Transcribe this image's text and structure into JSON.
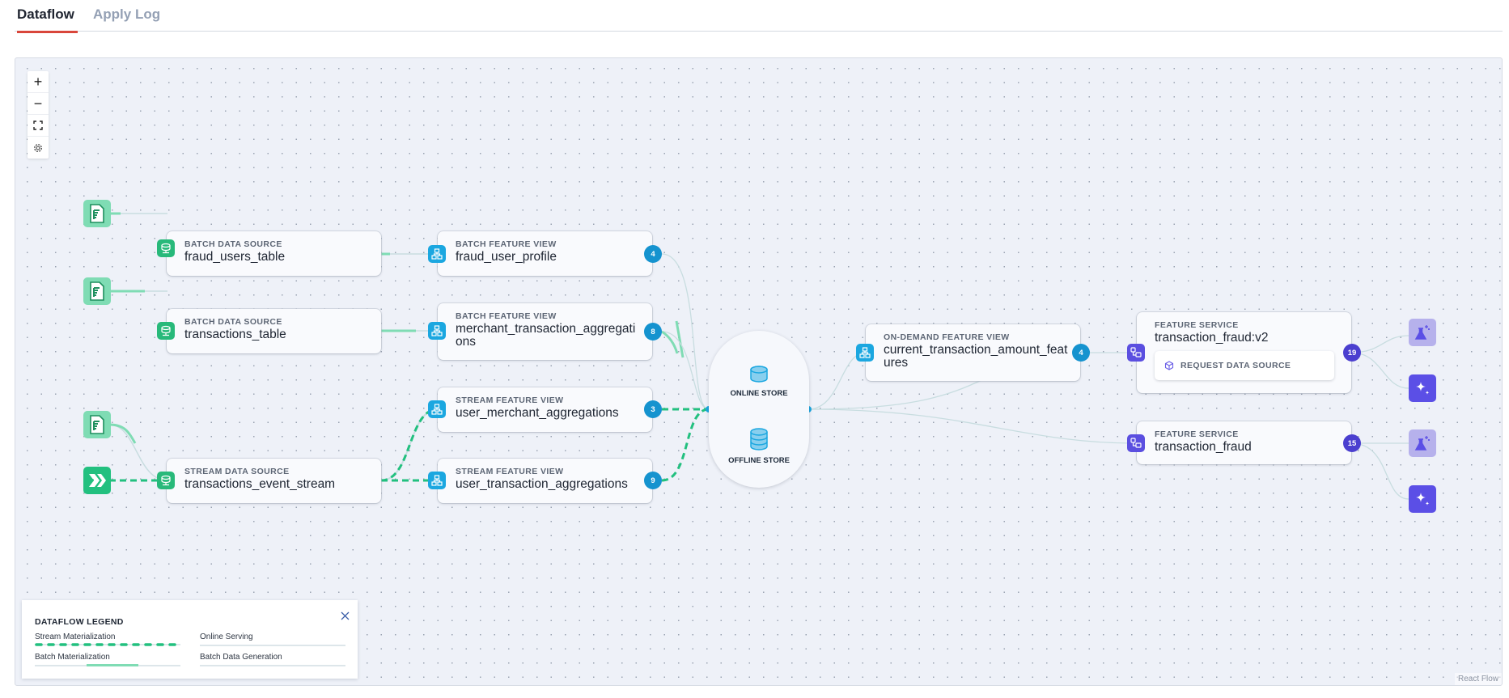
{
  "tabs": [
    {
      "label": "Dataflow",
      "active": true
    },
    {
      "label": "Apply Log",
      "active": false
    }
  ],
  "controls": {
    "zoom_in": "+",
    "zoom_out": "−",
    "fit_view": "fit-view",
    "settings": "settings"
  },
  "sources": [
    {
      "icon": "file-icon",
      "kind": "BATCH DATA SOURCE",
      "name": "fraud_users_table"
    },
    {
      "icon": "file-icon",
      "kind": "BATCH DATA SOURCE",
      "name": "transactions_table"
    },
    {
      "icon": "file-icon",
      "kind": "STREAM DATA SOURCE",
      "name": "transactions_event_stream",
      "stream_icon": "push-stream-icon"
    }
  ],
  "feature_views": [
    {
      "kind": "BATCH FEATURE VIEW",
      "name": "fraud_user_profile",
      "count": "4"
    },
    {
      "kind": "BATCH FEATURE VIEW",
      "name": "merchant_transaction_aggregations",
      "count": "8"
    },
    {
      "kind": "STREAM FEATURE VIEW",
      "name": "user_merchant_aggregations",
      "count": "3"
    },
    {
      "kind": "STREAM FEATURE VIEW",
      "name": "user_transaction_aggregations",
      "count": "9"
    }
  ],
  "stores": {
    "online": "ONLINE STORE",
    "offline": "OFFLINE STORE"
  },
  "odfv": {
    "kind": "ON-DEMAND FEATURE VIEW",
    "name": "current_transaction_amount_features",
    "count": "4"
  },
  "feature_services": [
    {
      "kind": "FEATURE SERVICE",
      "name": "transaction_fraud:v2",
      "count": "19",
      "request_source": "REQUEST DATA SOURCE"
    },
    {
      "kind": "FEATURE SERVICE",
      "name": "transaction_fraud",
      "count": "15"
    }
  ],
  "legend": {
    "title": "DATAFLOW LEGEND",
    "items": [
      {
        "label": "Stream Materialization"
      },
      {
        "label": "Online Serving"
      },
      {
        "label": "Batch Materialization"
      },
      {
        "label": "Batch Data Generation"
      }
    ]
  },
  "colors": {
    "tab_accent": "#d9463b",
    "stream": "#22c07f",
    "batch": "#7fdcb4",
    "feature_view": "#1ba7e0",
    "feature_service": "#5b4fe0",
    "serving_edge": "#c8dde0"
  },
  "attribution": "React Flow"
}
